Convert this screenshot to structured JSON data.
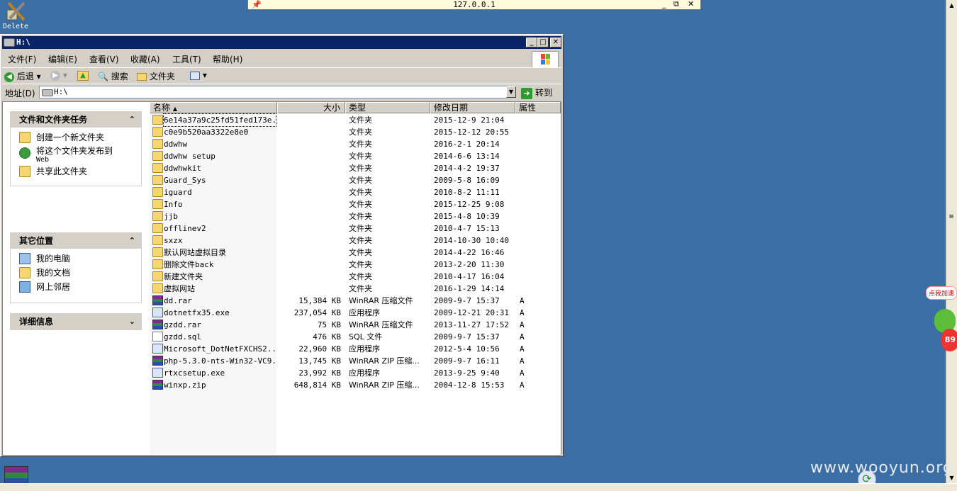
{
  "desktop": {
    "delete_icon_label": "Delete",
    "watermark": "www.wooyun.org",
    "badge_text": "点我加速",
    "badge_number": "89"
  },
  "rdp": {
    "title": "127.0.0.1",
    "min": "_",
    "restore": "⧉",
    "close": "✕"
  },
  "window": {
    "title": "H:\\",
    "btn_min": "_",
    "btn_max": "□",
    "btn_close": "✕",
    "menu": [
      "文件(F)",
      "编辑(E)",
      "查看(V)",
      "收藏(A)",
      "工具(T)",
      "帮助(H)"
    ],
    "toolbar": {
      "back": "后退",
      "search": "搜索",
      "folders": "文件夹"
    },
    "address": {
      "label": "地址(D)",
      "value": "H:\\",
      "go": "转到"
    }
  },
  "tasks": {
    "panel1": {
      "title": "文件和文件夹任务",
      "items": [
        "创建一个新文件夹",
        "将这个文件夹发布到",
        "Web",
        "共享此文件夹"
      ]
    },
    "panel2": {
      "title": "其它位置",
      "items": [
        "我的电脑",
        "我的文档",
        "网上邻居"
      ]
    },
    "panel3": {
      "title": "详细信息"
    }
  },
  "columns": [
    "名称",
    "大小",
    "类型",
    "修改日期",
    "属性"
  ],
  "files": [
    {
      "name": "6e14a37a9c25fd51fed173e...",
      "size": "",
      "type": "文件夹",
      "date": "2015-12-9 21:04",
      "attr": "",
      "icon": "folder"
    },
    {
      "name": "c0e9b520aa3322e8e0",
      "size": "",
      "type": "文件夹",
      "date": "2015-12-12 20:55",
      "attr": "",
      "icon": "folder"
    },
    {
      "name": "ddwhw",
      "size": "",
      "type": "文件夹",
      "date": "2016-2-1 20:14",
      "attr": "",
      "icon": "folder"
    },
    {
      "name": "ddwhw setup",
      "size": "",
      "type": "文件夹",
      "date": "2014-6-6 13:14",
      "attr": "",
      "icon": "folder"
    },
    {
      "name": "ddwhwkit",
      "size": "",
      "type": "文件夹",
      "date": "2014-4-2 19:37",
      "attr": "",
      "icon": "folder"
    },
    {
      "name": "Guard_Sys",
      "size": "",
      "type": "文件夹",
      "date": "2009-5-8 16:09",
      "attr": "",
      "icon": "folder"
    },
    {
      "name": "iguard",
      "size": "",
      "type": "文件夹",
      "date": "2010-8-2 11:11",
      "attr": "",
      "icon": "folder"
    },
    {
      "name": "Info",
      "size": "",
      "type": "文件夹",
      "date": "2015-12-25 9:08",
      "attr": "",
      "icon": "folder"
    },
    {
      "name": "jjb",
      "size": "",
      "type": "文件夹",
      "date": "2015-4-8 10:39",
      "attr": "",
      "icon": "folder"
    },
    {
      "name": "offlinev2",
      "size": "",
      "type": "文件夹",
      "date": "2010-4-7 15:13",
      "attr": "",
      "icon": "folder"
    },
    {
      "name": "sxzx",
      "size": "",
      "type": "文件夹",
      "date": "2014-10-30 10:40",
      "attr": "",
      "icon": "folder"
    },
    {
      "name": "默认网站虚拟目录",
      "size": "",
      "type": "文件夹",
      "date": "2014-4-22 16:46",
      "attr": "",
      "icon": "folder"
    },
    {
      "name": "删除文件back",
      "size": "",
      "type": "文件夹",
      "date": "2013-2-20 11:30",
      "attr": "",
      "icon": "folder"
    },
    {
      "name": "新建文件夹",
      "size": "",
      "type": "文件夹",
      "date": "2010-4-17 16:04",
      "attr": "",
      "icon": "folder"
    },
    {
      "name": "虚拟网站",
      "size": "",
      "type": "文件夹",
      "date": "2016-1-29 14:14",
      "attr": "",
      "icon": "folder"
    },
    {
      "name": "dd.rar",
      "size": "15,384 KB",
      "type": "WinRAR 压缩文件",
      "date": "2009-9-7 15:37",
      "attr": "A",
      "icon": "rar"
    },
    {
      "name": "dotnetfx35.exe",
      "size": "237,054 KB",
      "type": "应用程序",
      "date": "2009-12-21 20:31",
      "attr": "A",
      "icon": "exe"
    },
    {
      "name": "gzdd.rar",
      "size": "75 KB",
      "type": "WinRAR 压缩文件",
      "date": "2013-11-27 17:52",
      "attr": "A",
      "icon": "rar"
    },
    {
      "name": "gzdd.sql",
      "size": "476 KB",
      "type": "SQL 文件",
      "date": "2009-9-7 15:37",
      "attr": "A",
      "icon": "sql"
    },
    {
      "name": "Microsoft_DotNetFXCHS2...",
      "size": "22,960 KB",
      "type": "应用程序",
      "date": "2012-5-4 10:56",
      "attr": "A",
      "icon": "exe"
    },
    {
      "name": "php-5.3.0-nts-Win32-VC9...",
      "size": "13,745 KB",
      "type": "WinRAR ZIP 压缩...",
      "date": "2009-9-7 16:11",
      "attr": "A",
      "icon": "rar"
    },
    {
      "name": "rtxcsetup.exe",
      "size": "23,992 KB",
      "type": "应用程序",
      "date": "2013-9-25 9:40",
      "attr": "A",
      "icon": "exe"
    },
    {
      "name": "winxp.zip",
      "size": "648,814 KB",
      "type": "WinRAR ZIP 压缩...",
      "date": "2004-12-8 15:53",
      "attr": "A",
      "icon": "rar"
    }
  ],
  "colors": {
    "desktop": "#3a6ea5",
    "titlebar": "#0a246a",
    "chrome": "#d4d0c8",
    "folder": "#f6d66e"
  }
}
